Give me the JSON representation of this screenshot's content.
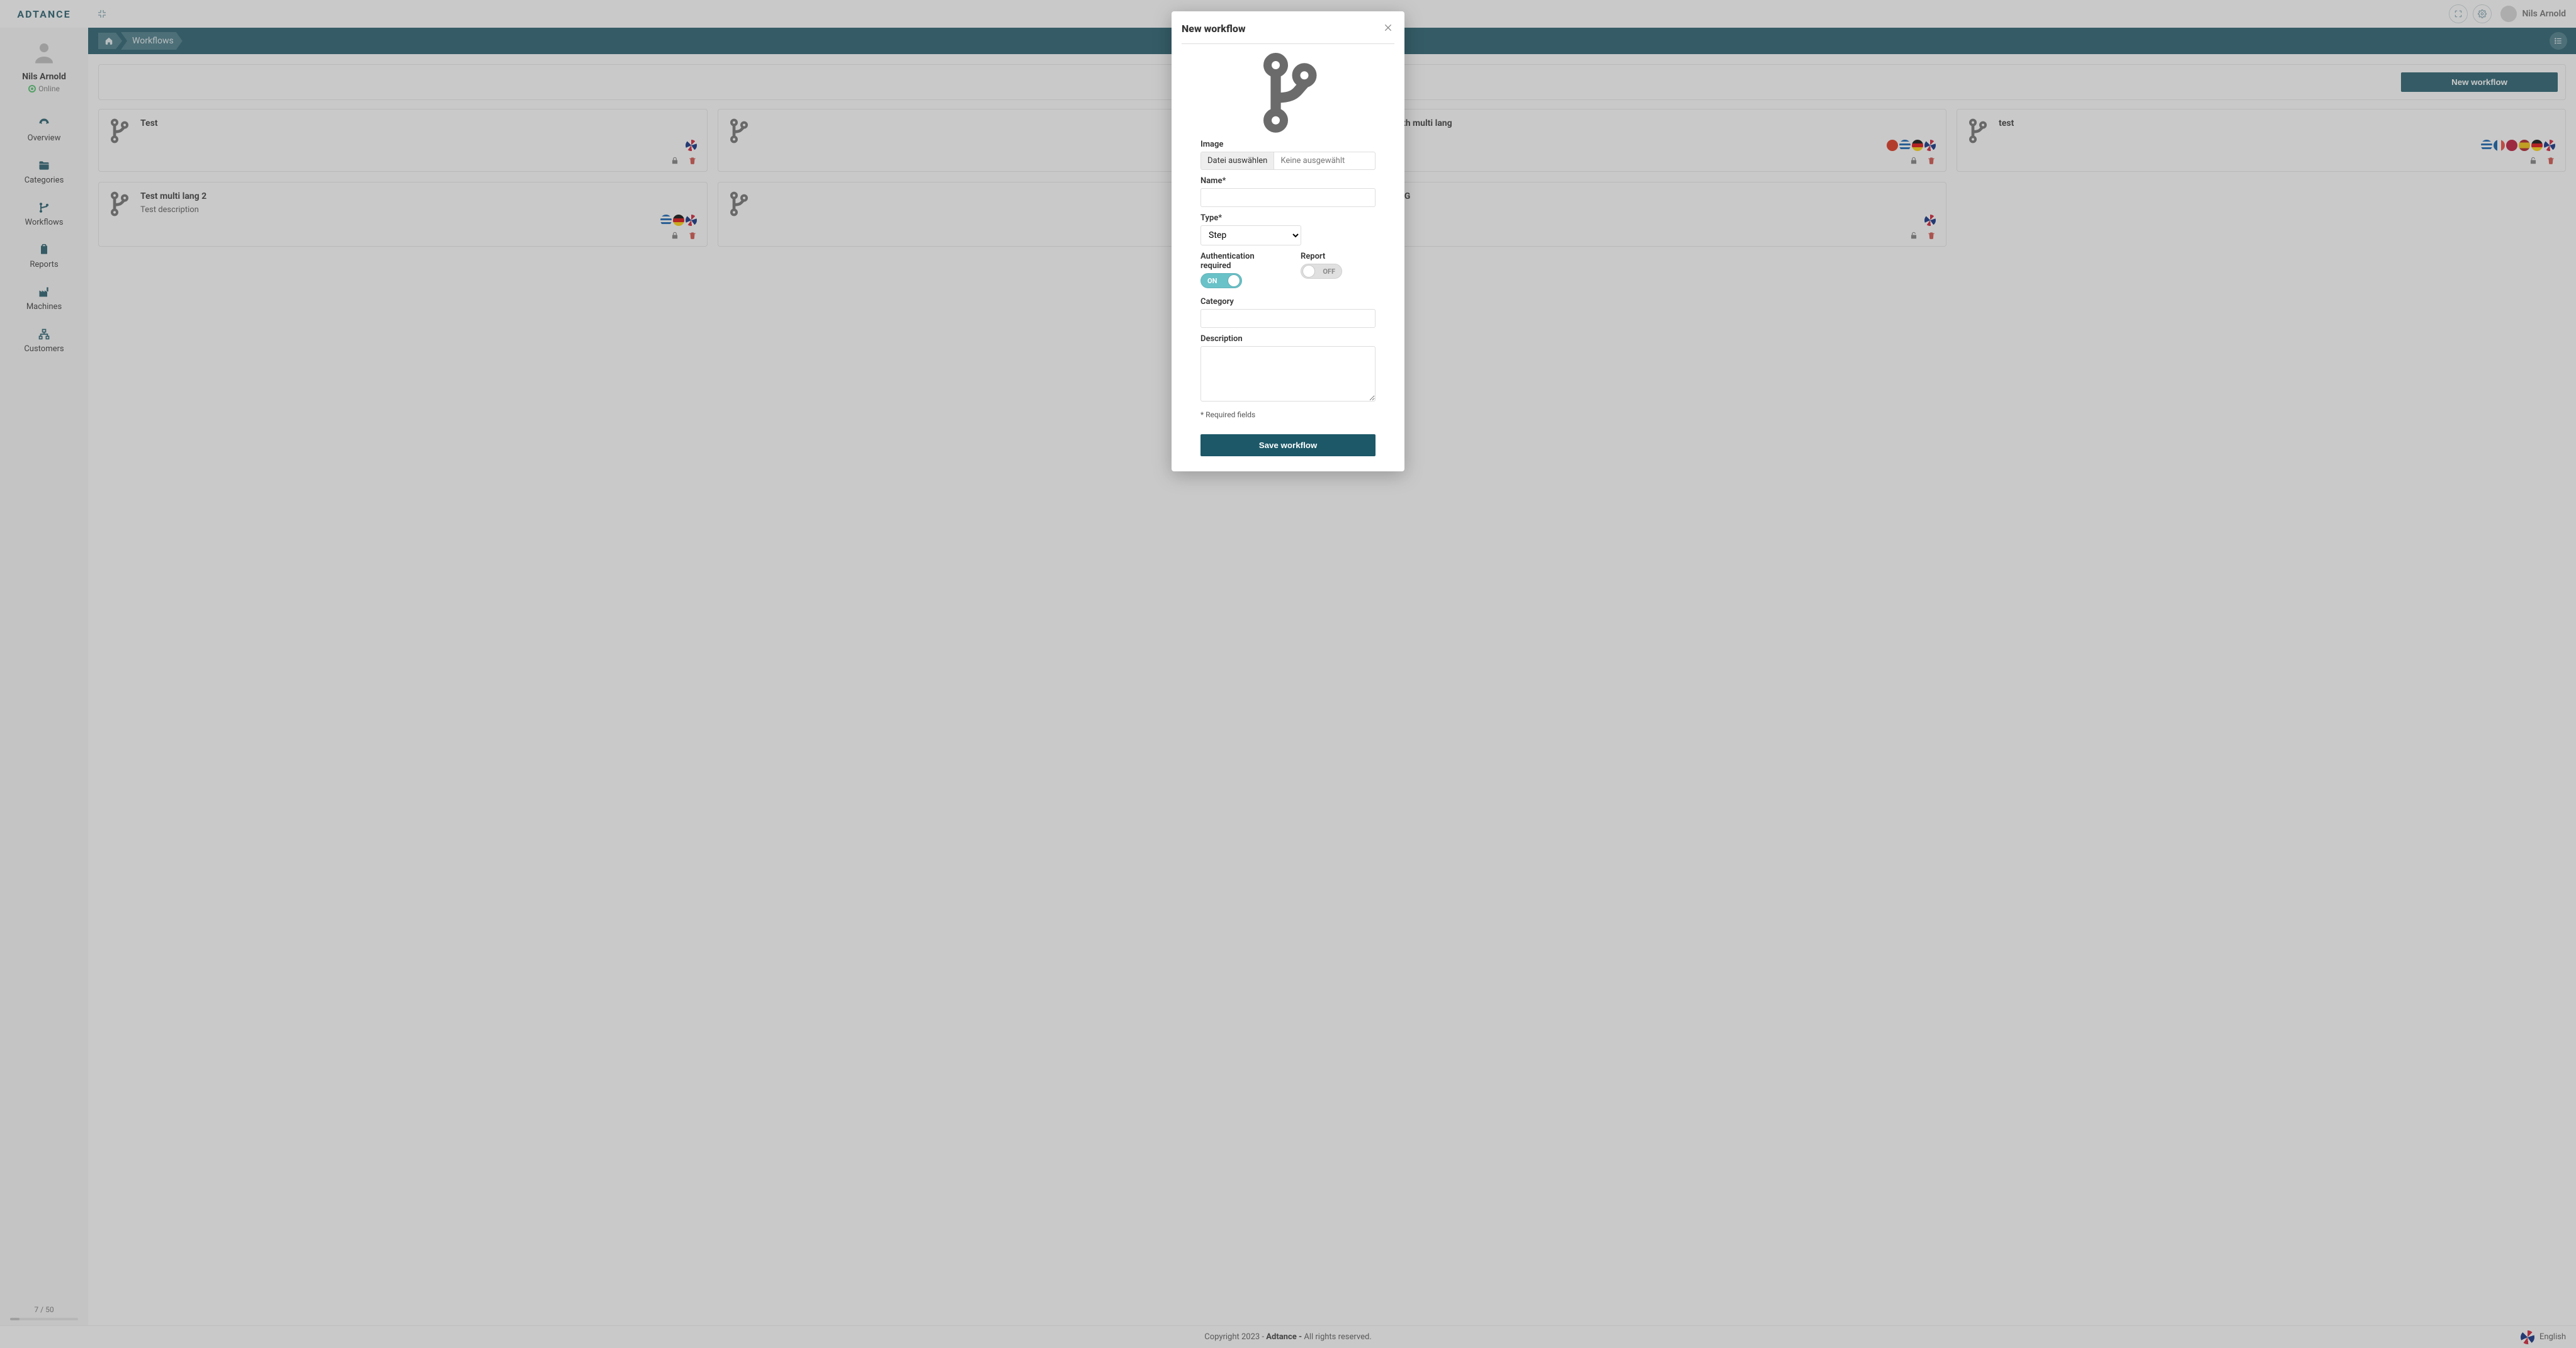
{
  "logo_text": "ADTANCE",
  "header": {
    "user_name": "Nils Arnold"
  },
  "sidebar": {
    "user_name": "Nils Arnold",
    "status": "Online",
    "items": [
      {
        "label": "Overview"
      },
      {
        "label": "Categories"
      },
      {
        "label": "Workflows"
      },
      {
        "label": "Reports"
      },
      {
        "label": "Machines"
      },
      {
        "label": "Customers"
      }
    ],
    "quota": "7 / 50"
  },
  "breadcrumb": {
    "items": [
      "Workflows"
    ]
  },
  "toolbar": {
    "new_workflow": "New workflow"
  },
  "cards": [
    {
      "title": "Test",
      "desc": "",
      "flags": [
        "gb"
      ],
      "locked": true
    },
    {
      "title": "",
      "desc": "",
      "flags": [],
      "locked": true
    },
    {
      "title": "est with multi lang",
      "desc": "",
      "flags": [
        "cn",
        "gr",
        "de",
        "gb"
      ],
      "locked": true
    },
    {
      "title": "test",
      "desc": "",
      "flags": [
        "gr",
        "fr",
        "no",
        "es",
        "de",
        "gb"
      ],
      "locked": false
    },
    {
      "title": "Test multi lang 2",
      "desc": "Test description",
      "flags": [
        "gr",
        "de",
        "gb"
      ],
      "locked": true
    },
    {
      "title": "",
      "desc": "",
      "flags": [],
      "locked": true
    },
    {
      "title": "emo KG",
      "desc": "",
      "flags": [
        "gb"
      ],
      "locked": false
    }
  ],
  "footer": {
    "copyright_pre": "Copyright 2023 - ",
    "brand": "Adtance - ",
    "rights": "All rights reserved.",
    "language": "English"
  },
  "modal": {
    "title": "New workflow",
    "image_label": "Image",
    "file_choose": "Datei auswählen",
    "file_status": "Keine ausgewählt",
    "name_label": "Name*",
    "name_value": "",
    "type_label": "Type*",
    "type_value": "Step",
    "auth_label": "Authentication required",
    "auth_on_label": "ON",
    "report_label": "Report",
    "report_off_label": "OFF",
    "category_label": "Category",
    "category_value": "",
    "description_label": "Description",
    "description_value": "",
    "required_hint": "* Required fields",
    "save_label": "Save workflow"
  }
}
